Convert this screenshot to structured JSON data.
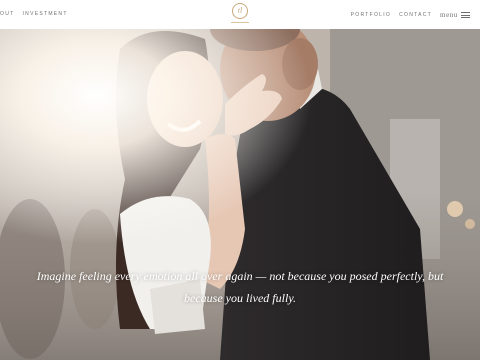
{
  "nav": {
    "left_items": [
      "OUT",
      "INVESTMENT"
    ],
    "right_items": [
      "PORTFOLIO",
      "CONTACT"
    ],
    "menu_label": "menu"
  },
  "logo": {
    "monogram": "tl"
  },
  "hero": {
    "caption_line1": "Imagine feeling every emotion all over again — not because you posed perfectly, but",
    "caption_line2": "because you lived fully."
  },
  "colors": {
    "accent_gold": "#c9a97a",
    "nav_text": "#6f6f6f",
    "caption_text": "#ffffff"
  }
}
